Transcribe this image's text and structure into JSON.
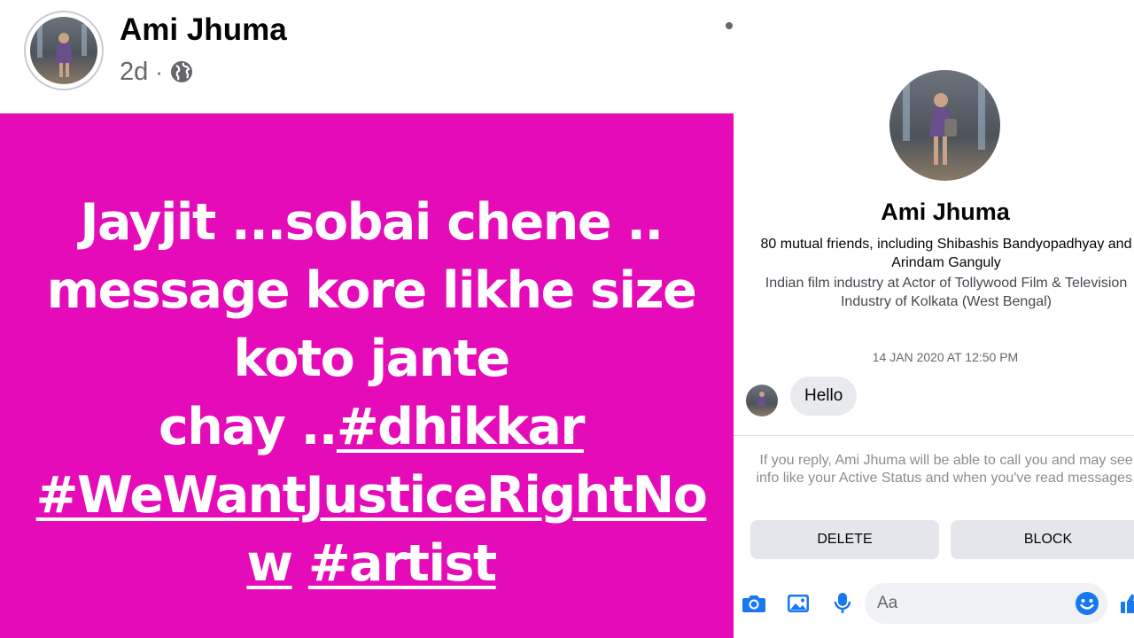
{
  "post": {
    "author": "Ami Jhuma",
    "time": "2d",
    "separator": "·",
    "privacy_icon": "globe-icon",
    "background_color": "#e60bb8",
    "text": {
      "line1": "Jayjit ...sobai chene ..",
      "line2": "message kore likhe size",
      "line3": "koto jante",
      "line4_prefix": "chay ..",
      "hashtag1": "#dhikkar",
      "hashtag2_part1": "#WeWantJusticeRightNo",
      "hashtag2_part2": "w",
      "hashtag3": "#artist"
    }
  },
  "messenger": {
    "profile_name": "Ami Jhuma",
    "mutual_friends": "80 mutual friends, including Shibashis Bandyopadhyay and Arindam Ganguly",
    "work": "Indian film industry at Actor of Tollywood Film & Television Industry of Kolkata (West Bengal)",
    "timestamp": "14 JAN 2020 AT 12:50 PM",
    "message": "Hello",
    "notice": "If you reply, Ami Jhuma will be able to call you and may see info like your Active Status and when you've read messages.",
    "delete_label": "DELETE",
    "block_label": "BLOCK",
    "input_placeholder": "Aa",
    "accent_color": "#1877f2",
    "icons": [
      "camera-icon",
      "image-icon",
      "microphone-icon",
      "emoji-icon",
      "thumbs-up-icon"
    ]
  }
}
